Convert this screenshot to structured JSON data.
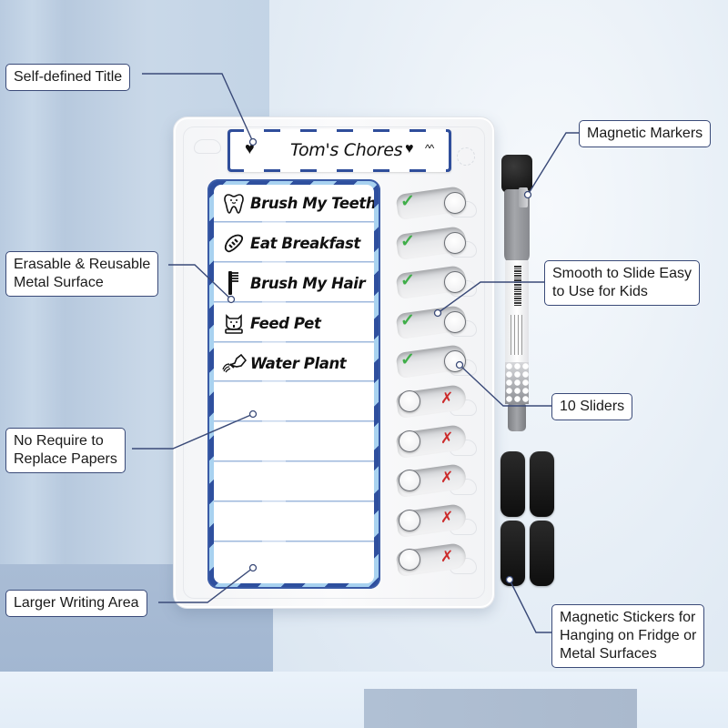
{
  "product": {
    "title_strip": {
      "title": "Tom's Chores",
      "left_icon": "heart-icon",
      "right_icons": [
        "heart-icon",
        "smile-face-icon"
      ]
    },
    "chores": [
      {
        "label": "Brush My Teeth",
        "icon": "tooth-icon"
      },
      {
        "label": "Eat Breakfast",
        "icon": "bread-icon"
      },
      {
        "label": "Brush My Hair",
        "icon": "comb-icon"
      },
      {
        "label": "Feed Pet",
        "icon": "pet-bowl-icon"
      },
      {
        "label": "Water Plant",
        "icon": "watering-can-icon"
      },
      {
        "label": "",
        "icon": ""
      },
      {
        "label": "",
        "icon": ""
      },
      {
        "label": "",
        "icon": ""
      },
      {
        "label": "",
        "icon": ""
      },
      {
        "label": "",
        "icon": ""
      }
    ],
    "sliders": [
      {
        "state": "done",
        "mark": "✓"
      },
      {
        "state": "done",
        "mark": "✓"
      },
      {
        "state": "done",
        "mark": "✓"
      },
      {
        "state": "done",
        "mark": "✓"
      },
      {
        "state": "done",
        "mark": "✓"
      },
      {
        "state": "todo",
        "mark": "✗"
      },
      {
        "state": "todo",
        "mark": "✗"
      },
      {
        "state": "todo",
        "mark": "✗"
      },
      {
        "state": "todo",
        "mark": "✗"
      },
      {
        "state": "todo",
        "mark": "✗"
      }
    ],
    "colors": {
      "stripe_dark": "#2e4f9e",
      "stripe_light": "#a8d2f0",
      "check_green": "#3fae49",
      "cross_red": "#cc2a2a",
      "callout_border": "#3a4a78"
    }
  },
  "callouts": {
    "self_defined_title": "Self-defined Title",
    "magnetic_markers": "Magnetic Markers",
    "erasable_line1": "Erasable & Reusable",
    "erasable_line2": "Metal Surface",
    "smooth_line1": "Smooth to Slide Easy",
    "smooth_line2": "to Use for Kids",
    "ten_sliders": "10 Sliders",
    "no_require_line1": "No Require to",
    "no_require_line2": "Replace Papers",
    "larger_writing_area": "Larger Writing Area",
    "stickers_line1": "Magnetic Stickers for",
    "stickers_line2": "Hanging on Fridge or",
    "stickers_line3": "Metal Surfaces"
  }
}
